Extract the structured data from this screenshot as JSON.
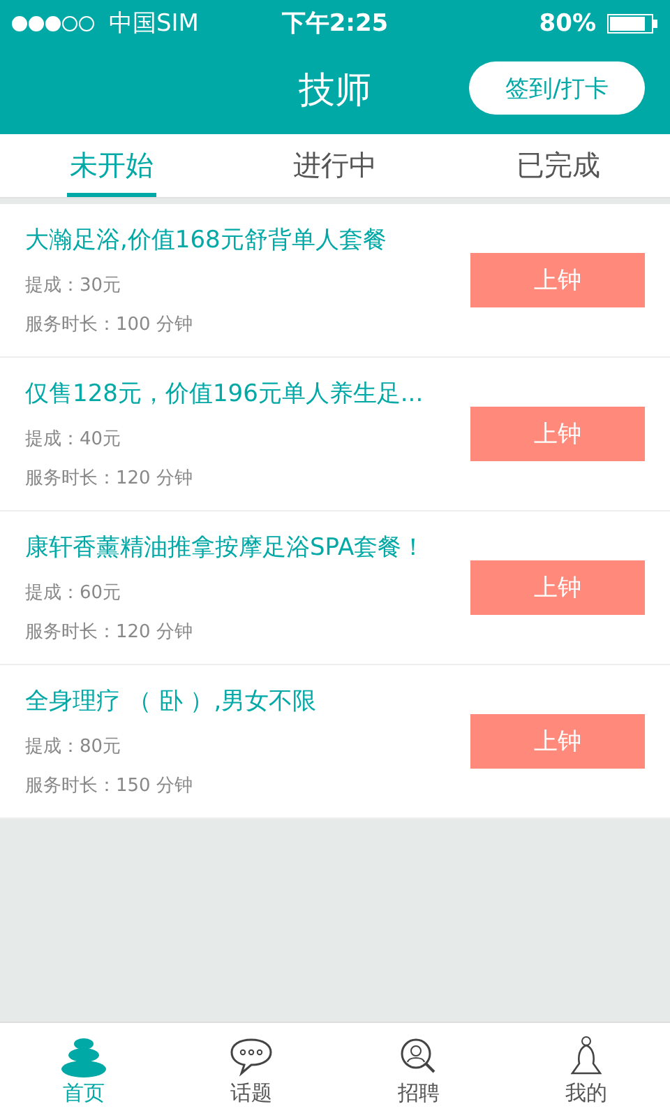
{
  "status_bar": {
    "carrier": "中国SIM",
    "time": "下午2:25",
    "battery": "80%"
  },
  "header": {
    "title": "技师",
    "action": "签到/打卡"
  },
  "tabs": [
    {
      "label": "未开始",
      "selected": true
    },
    {
      "label": "进行中",
      "selected": false
    },
    {
      "label": "已完成",
      "selected": false
    }
  ],
  "orders": [
    {
      "title": "大瀚足浴,价值168元舒背单人套餐",
      "commission": "提成：30元",
      "duration": "服务时长：100 分钟",
      "button": "上钟"
    },
    {
      "title": "仅售128元，价值196元单人养生足...",
      "commission": "提成：40元",
      "duration": "服务时长：120 分钟",
      "button": "上钟"
    },
    {
      "title": "康轩香薰精油推拿按摩足浴SPA套餐！",
      "commission": "提成：60元",
      "duration": "服务时长：120 分钟",
      "button": "上钟"
    },
    {
      "title": "全身理疗 （ 卧 ）,男女不限",
      "commission": "提成：80元",
      "duration": "服务时长：150 分钟",
      "button": "上钟"
    }
  ],
  "nav": [
    {
      "kind": "home",
      "label": "首页",
      "selected": true
    },
    {
      "kind": "topics",
      "label": "话题",
      "selected": false
    },
    {
      "kind": "jobs",
      "label": "招聘",
      "selected": false
    },
    {
      "kind": "profile",
      "label": "我的",
      "selected": false
    }
  ]
}
